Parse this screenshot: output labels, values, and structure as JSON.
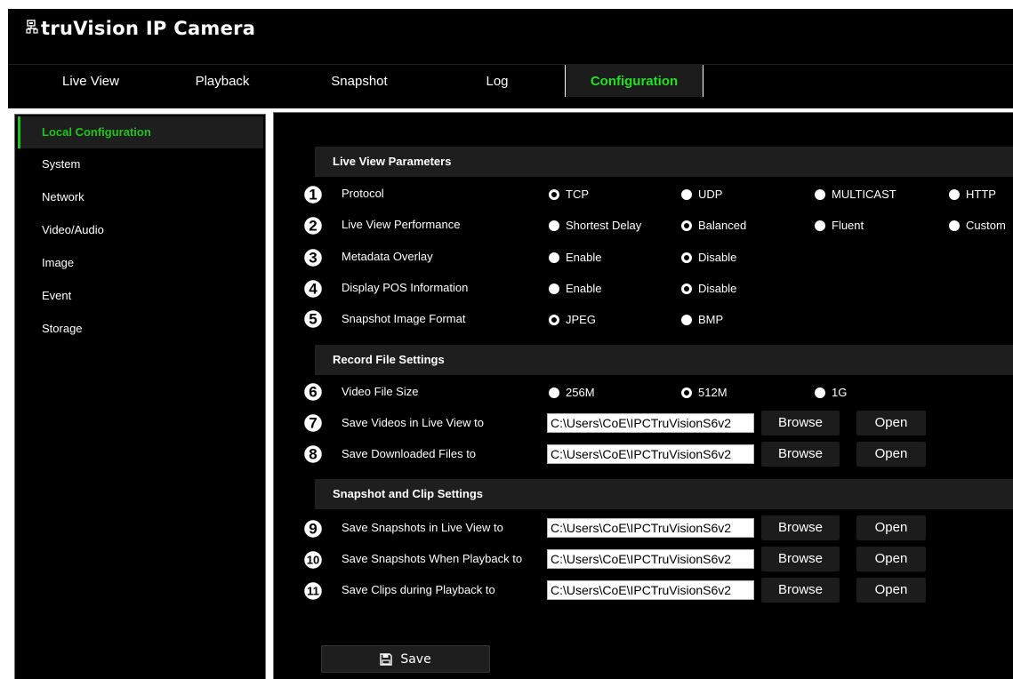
{
  "app": {
    "brand": "truVision IP Camera"
  },
  "nav": {
    "tabs": [
      {
        "label": "Live View"
      },
      {
        "label": "Playback"
      },
      {
        "label": "Snapshot"
      },
      {
        "label": "Log"
      },
      {
        "label": "Configuration",
        "active": true
      }
    ]
  },
  "sidebar": {
    "items": [
      {
        "label": "Local Configuration",
        "active": true
      },
      {
        "label": "System"
      },
      {
        "label": "Network"
      },
      {
        "label": "Video/Audio"
      },
      {
        "label": "Image"
      },
      {
        "label": "Event"
      },
      {
        "label": "Storage"
      }
    ]
  },
  "sections": {
    "live_view": "Live View Parameters",
    "record_file": "Record File Settings",
    "snapshot_clip": "Snapshot and Clip Settings"
  },
  "rows": {
    "protocol": {
      "number": "1",
      "label": "Protocol",
      "selected": "TCP",
      "options": [
        "TCP",
        "UDP",
        "MULTICAST",
        "HTTP"
      ]
    },
    "performance": {
      "number": "2",
      "label": "Live View Performance",
      "selected": "Balanced",
      "options": [
        "Shortest Delay",
        "Balanced",
        "Fluent",
        "Custom"
      ]
    },
    "metadata": {
      "number": "3",
      "label": "Metadata Overlay",
      "selected": "Disable",
      "options": [
        "Enable",
        "Disable"
      ]
    },
    "pos": {
      "number": "4",
      "label": "Display POS Information",
      "selected": "Disable",
      "options": [
        "Enable",
        "Disable"
      ]
    },
    "snapshot_format": {
      "number": "5",
      "label": "Snapshot Image Format",
      "selected": "JPEG",
      "options": [
        "JPEG",
        "BMP"
      ]
    },
    "file_size": {
      "number": "6",
      "label": "Video File Size",
      "selected": "512M",
      "options": [
        "256M",
        "512M",
        "1G"
      ]
    },
    "save_videos": {
      "number": "7",
      "label": "Save Videos in Live View to",
      "value": "C:\\Users\\CoE\\IPCTruVisionS6v2"
    },
    "save_downloads": {
      "number": "8",
      "label": "Save Downloaded Files to",
      "value": "C:\\Users\\CoE\\IPCTruVisionS6v2"
    },
    "save_snapshots_live": {
      "number": "9",
      "label": "Save Snapshots in Live View to",
      "value": "C:\\Users\\CoE\\IPCTruVisionS6v2"
    },
    "save_snapshots_playback": {
      "number": "10",
      "label": "Save Snapshots When Playback to",
      "value": "C:\\Users\\CoE\\IPCTruVisionS6v2"
    },
    "save_clips": {
      "number": "11",
      "label": "Save Clips during Playback to",
      "value": "C:\\Users\\CoE\\IPCTruVisionS6v2"
    }
  },
  "buttons": {
    "browse": "Browse",
    "open": "Open",
    "save": "Save"
  },
  "colors": {
    "accent_green": "#1fc51f",
    "background": "#000000",
    "panel": "#1e1e1e",
    "text": "#ffffff"
  },
  "icons": {
    "logo": "network-logo-icon",
    "save": "floppy-disk-icon",
    "row_number": "circled-number-icon"
  }
}
